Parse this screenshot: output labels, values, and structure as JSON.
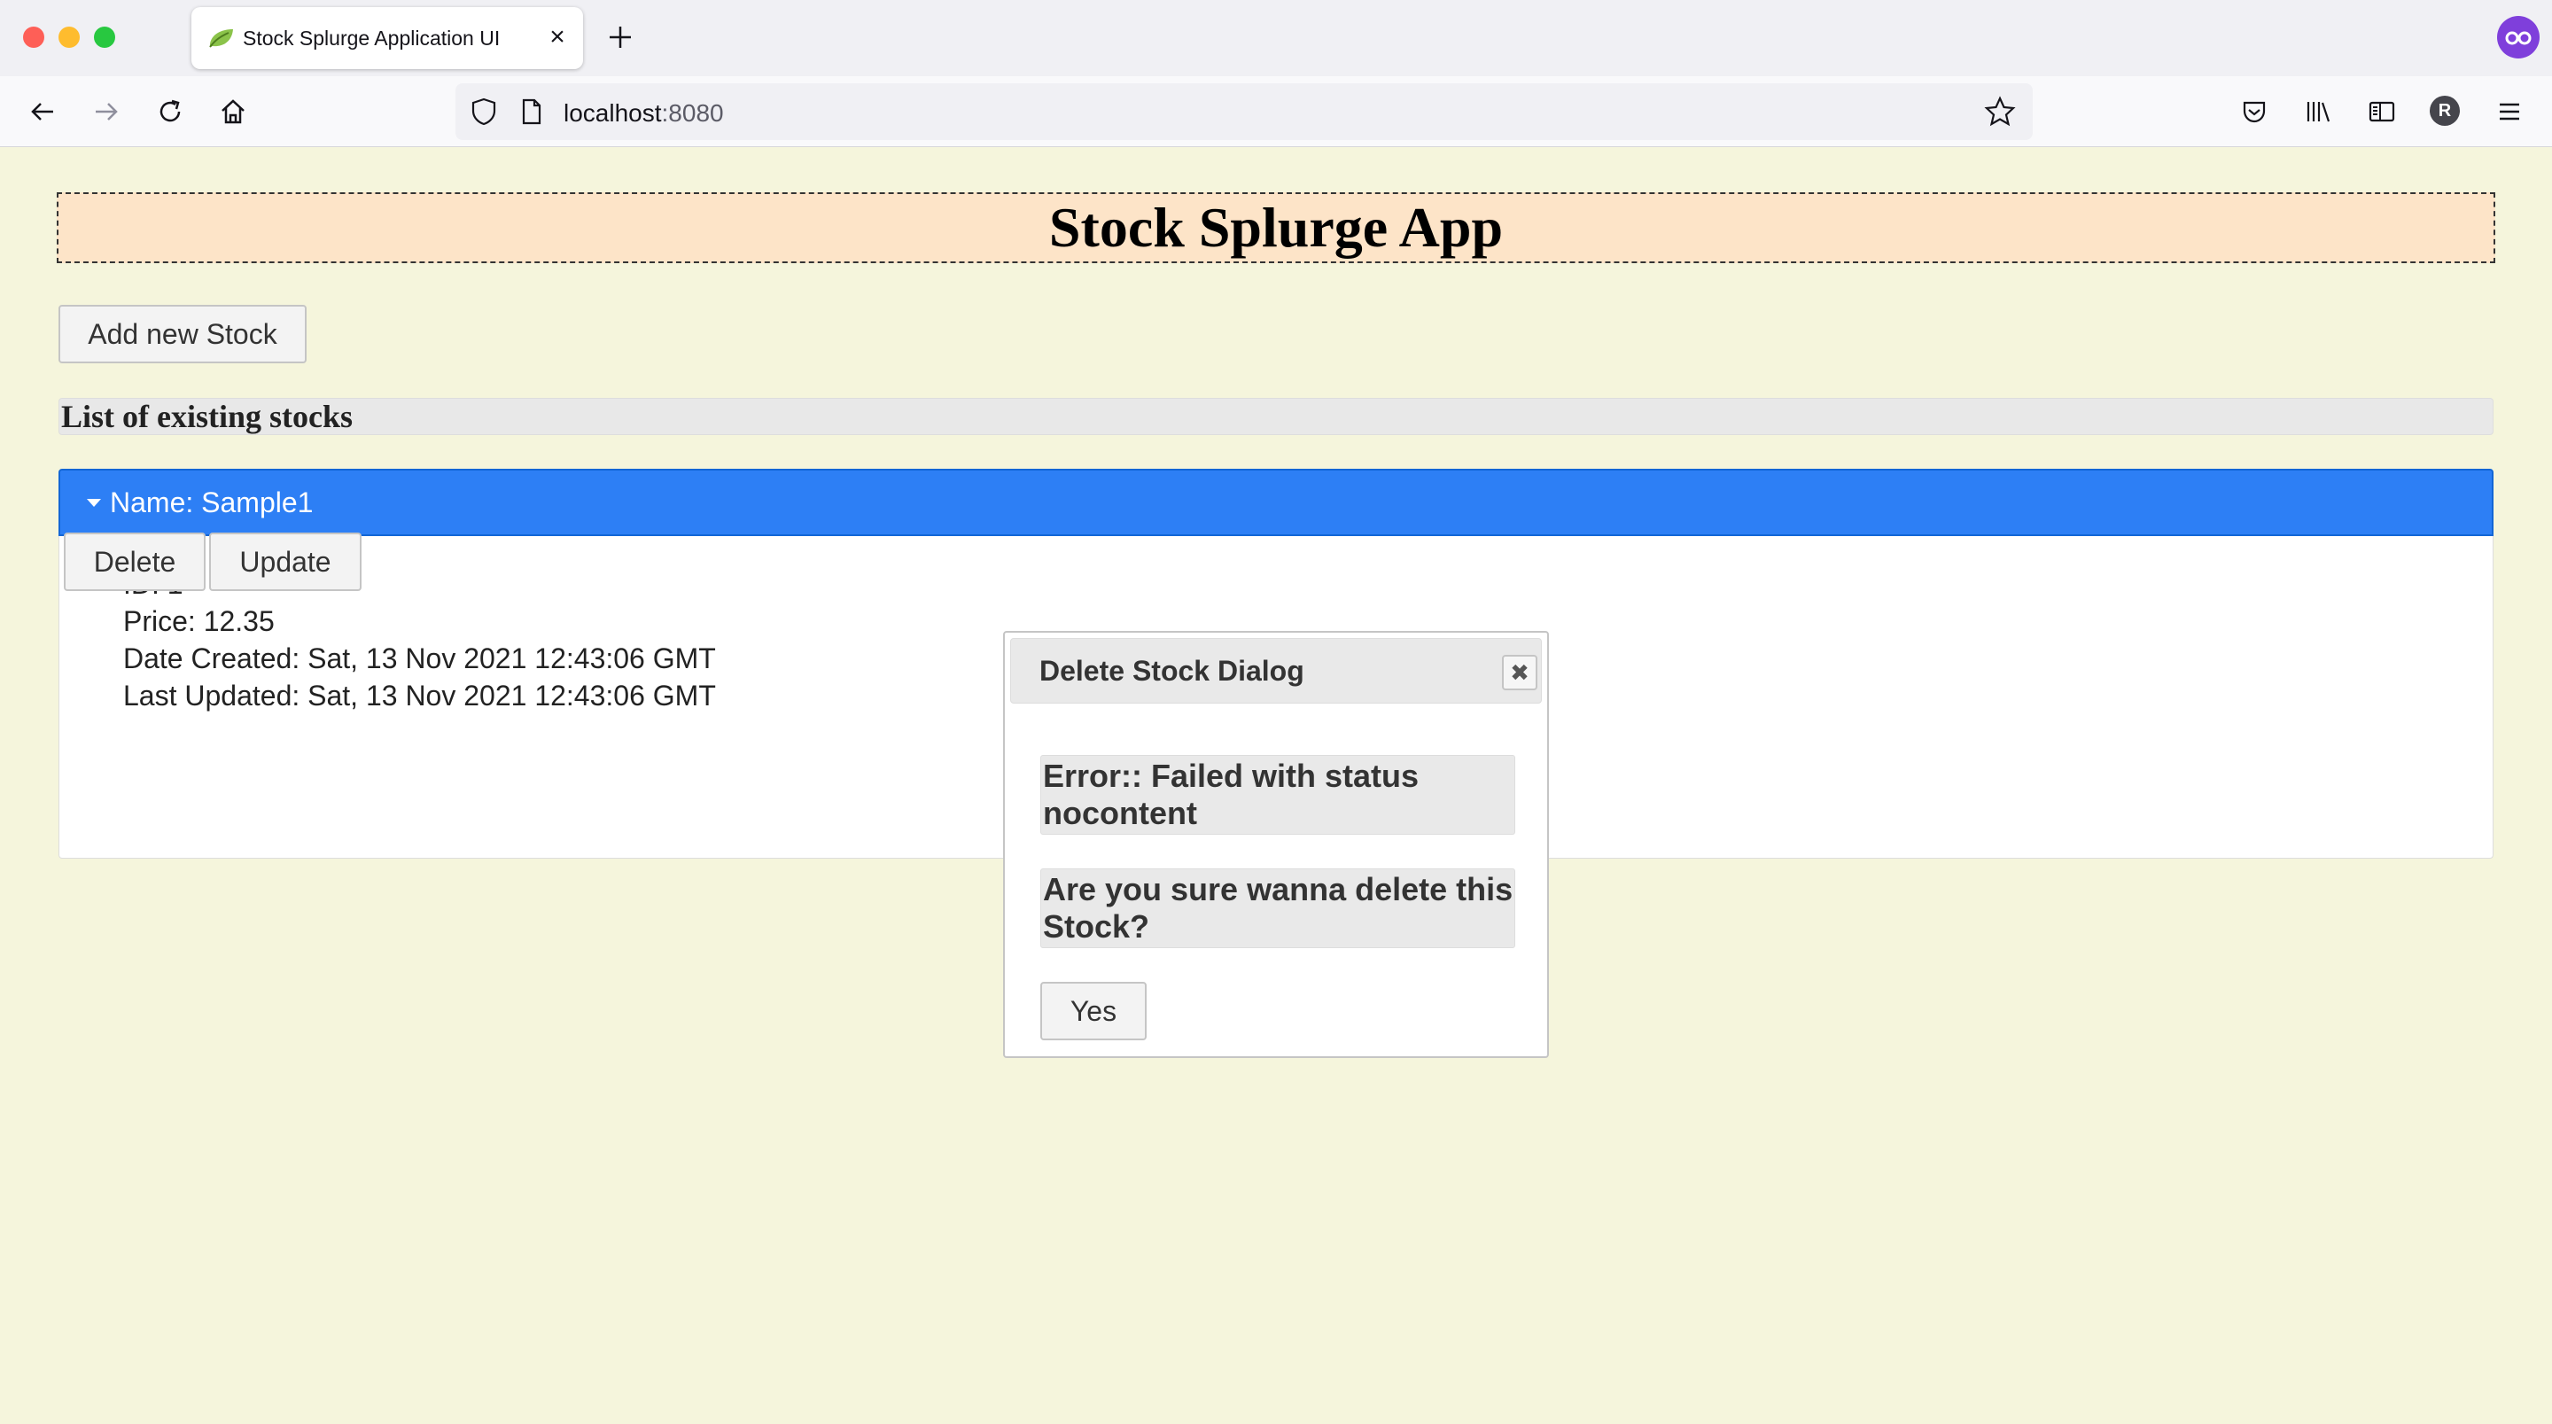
{
  "browser": {
    "tab_title": "Stock Splurge Application UI",
    "url_host": "localhost",
    "url_port": ":8080",
    "profile_initial": "R"
  },
  "page": {
    "title": "Stock Splurge App",
    "add_button_label": "Add new Stock",
    "list_heading": "List of existing stocks"
  },
  "stocks": [
    {
      "header": "Name: Sample1",
      "id_line": "ID: 1",
      "price_line": "Price: 12.35",
      "created_line": "Date Created: Sat, 13 Nov 2021 12:43:06 GMT",
      "updated_line": "Last Updated: Sat, 13 Nov 2021 12:43:06 GMT",
      "delete_label": "Delete",
      "update_label": "Update"
    }
  ],
  "dialog": {
    "title": "Delete Stock Dialog",
    "error_message": "Error:: Failed with status nocontent",
    "confirm_message": "Are you sure wanna delete this Stock?",
    "yes_label": "Yes"
  },
  "colors": {
    "page_background": "#f5f5dc",
    "header_background": "#fde4c8",
    "accordion_active": "#2d7ff5"
  },
  "icons": {
    "back": "arrow-left-icon",
    "forward": "arrow-right-icon",
    "reload": "reload-icon",
    "home": "home-icon",
    "shield": "shield-icon",
    "page": "page-icon",
    "bookmark": "star-icon",
    "pocket": "pocket-icon",
    "library": "library-icon",
    "sidebar": "sidebar-icon",
    "menu": "hamburger-menu-icon"
  }
}
